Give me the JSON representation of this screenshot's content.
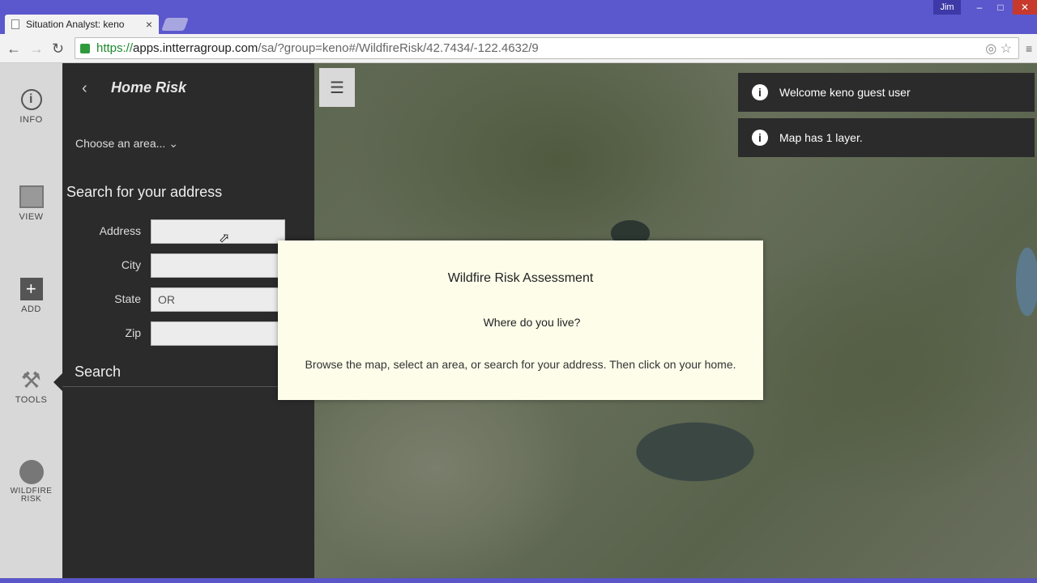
{
  "browser": {
    "tab_title": "Situation Analyst: keno",
    "tab_close": "×",
    "user": "Jim",
    "win_min": "‒",
    "win_max": "□",
    "win_close": "✕",
    "url_secure": "https://",
    "url_host": "apps.intterragroup.com",
    "url_rest": "/sa/?group=keno#/WildfireRisk/42.7434/-122.4632/9"
  },
  "leftbar": {
    "items": [
      {
        "label": "INFO",
        "icon": "info-icon"
      },
      {
        "label": "VIEW",
        "icon": "image-icon"
      },
      {
        "label": "ADD",
        "icon": "plus-icon"
      },
      {
        "label": "TOOLS",
        "icon": "tools-icon"
      },
      {
        "label": "WILDFIRE RISK",
        "icon": "person-icon"
      }
    ]
  },
  "panel": {
    "back": "‹",
    "title": "Home Risk",
    "choose_area": "Choose an area...",
    "search_heading": "Search for your address",
    "fields": [
      {
        "label": "Address",
        "value": ""
      },
      {
        "label": "City",
        "value": ""
      },
      {
        "label": "State",
        "value": "OR"
      },
      {
        "label": "Zip",
        "value": ""
      }
    ],
    "search_label": "Search"
  },
  "toasts": [
    "Welcome keno guest user",
    "Map has 1 layer."
  ],
  "modal": {
    "title": "Wildfire Risk Assessment",
    "question": "Where do you live?",
    "body": "Browse the map, select an area, or search for your address. Then click on your home."
  },
  "colors": {
    "titlebar": "#5b57cc",
    "panel": "#2b2b2b",
    "modal_bg": "#fdfdea"
  }
}
